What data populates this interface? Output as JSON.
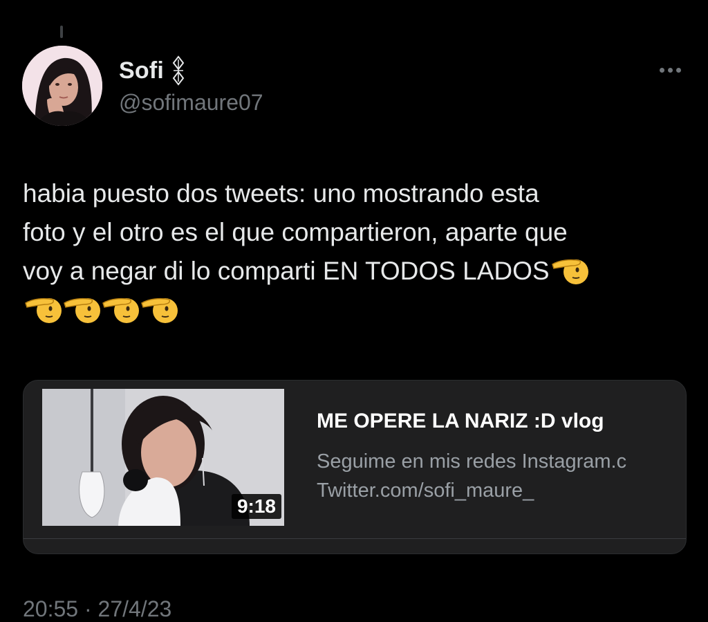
{
  "tweet": {
    "author": {
      "display_name": "Sofi",
      "handle": "@sofimaure07",
      "avatar_icon": "profile-photo",
      "name_decoration_icon": "diamond-ornament-icon"
    },
    "more_menu_icon": "more-horizontal-icon",
    "text_lines": [
      "habia puesto dos tweets: uno mostrando esta",
      "foto y el otro es el que compartieron, aparte que",
      "voy a negar di lo comparti EN TODOS LADOS"
    ],
    "emoji_name": "saluting-face",
    "emoji_count": 5,
    "timestamp": "20:55 · 27/4/23"
  },
  "link_card": {
    "thumbnail_icon": "video-thumbnail",
    "duration": "9:18",
    "title": "ME OPERE LA NARIZ :D vlog",
    "description_lines": [
      "Seguime en mis redes Instagram.c",
      "Twitter.com/sofi_maure_"
    ]
  },
  "colors": {
    "background": "#000000",
    "text_primary": "#e7e9ea",
    "text_secondary": "#71767b",
    "card_background": "#1f1f20",
    "card_description": "#9aa0a6"
  }
}
